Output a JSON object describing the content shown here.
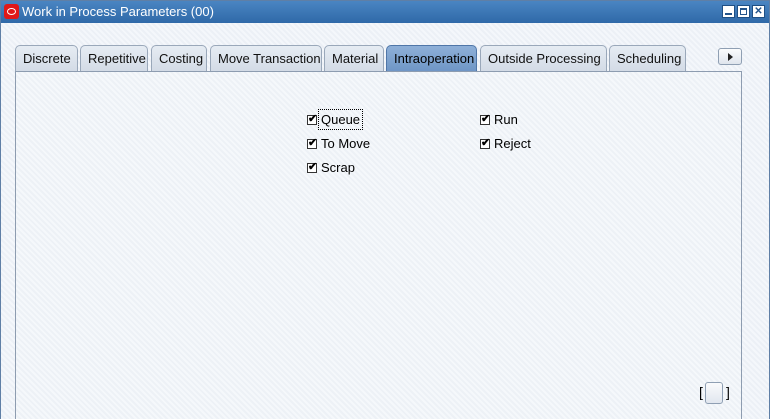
{
  "window": {
    "title": "Work in Process Parameters (00)"
  },
  "tabs": [
    {
      "label": "Discrete"
    },
    {
      "label": "Repetitive"
    },
    {
      "label": "Costing"
    },
    {
      "label": "Move Transaction"
    },
    {
      "label": "Material"
    },
    {
      "label": "Intraoperation"
    },
    {
      "label": "Outside Processing"
    },
    {
      "label": "Scheduling"
    }
  ],
  "active_tab": "Intraoperation",
  "checkboxes": {
    "queue": {
      "label": "Queue",
      "checked": true
    },
    "to_move": {
      "label": "To Move",
      "checked": true
    },
    "scrap": {
      "label": "Scrap",
      "checked": true
    },
    "run": {
      "label": "Run",
      "checked": true
    },
    "reject": {
      "label": "Reject",
      "checked": true
    }
  },
  "bracket": {
    "open": "[",
    "close": "]"
  },
  "colors": {
    "titlebar": "#3a76b6",
    "active_tab": "#7fa3cf",
    "oracle_logo": "#e01818"
  }
}
